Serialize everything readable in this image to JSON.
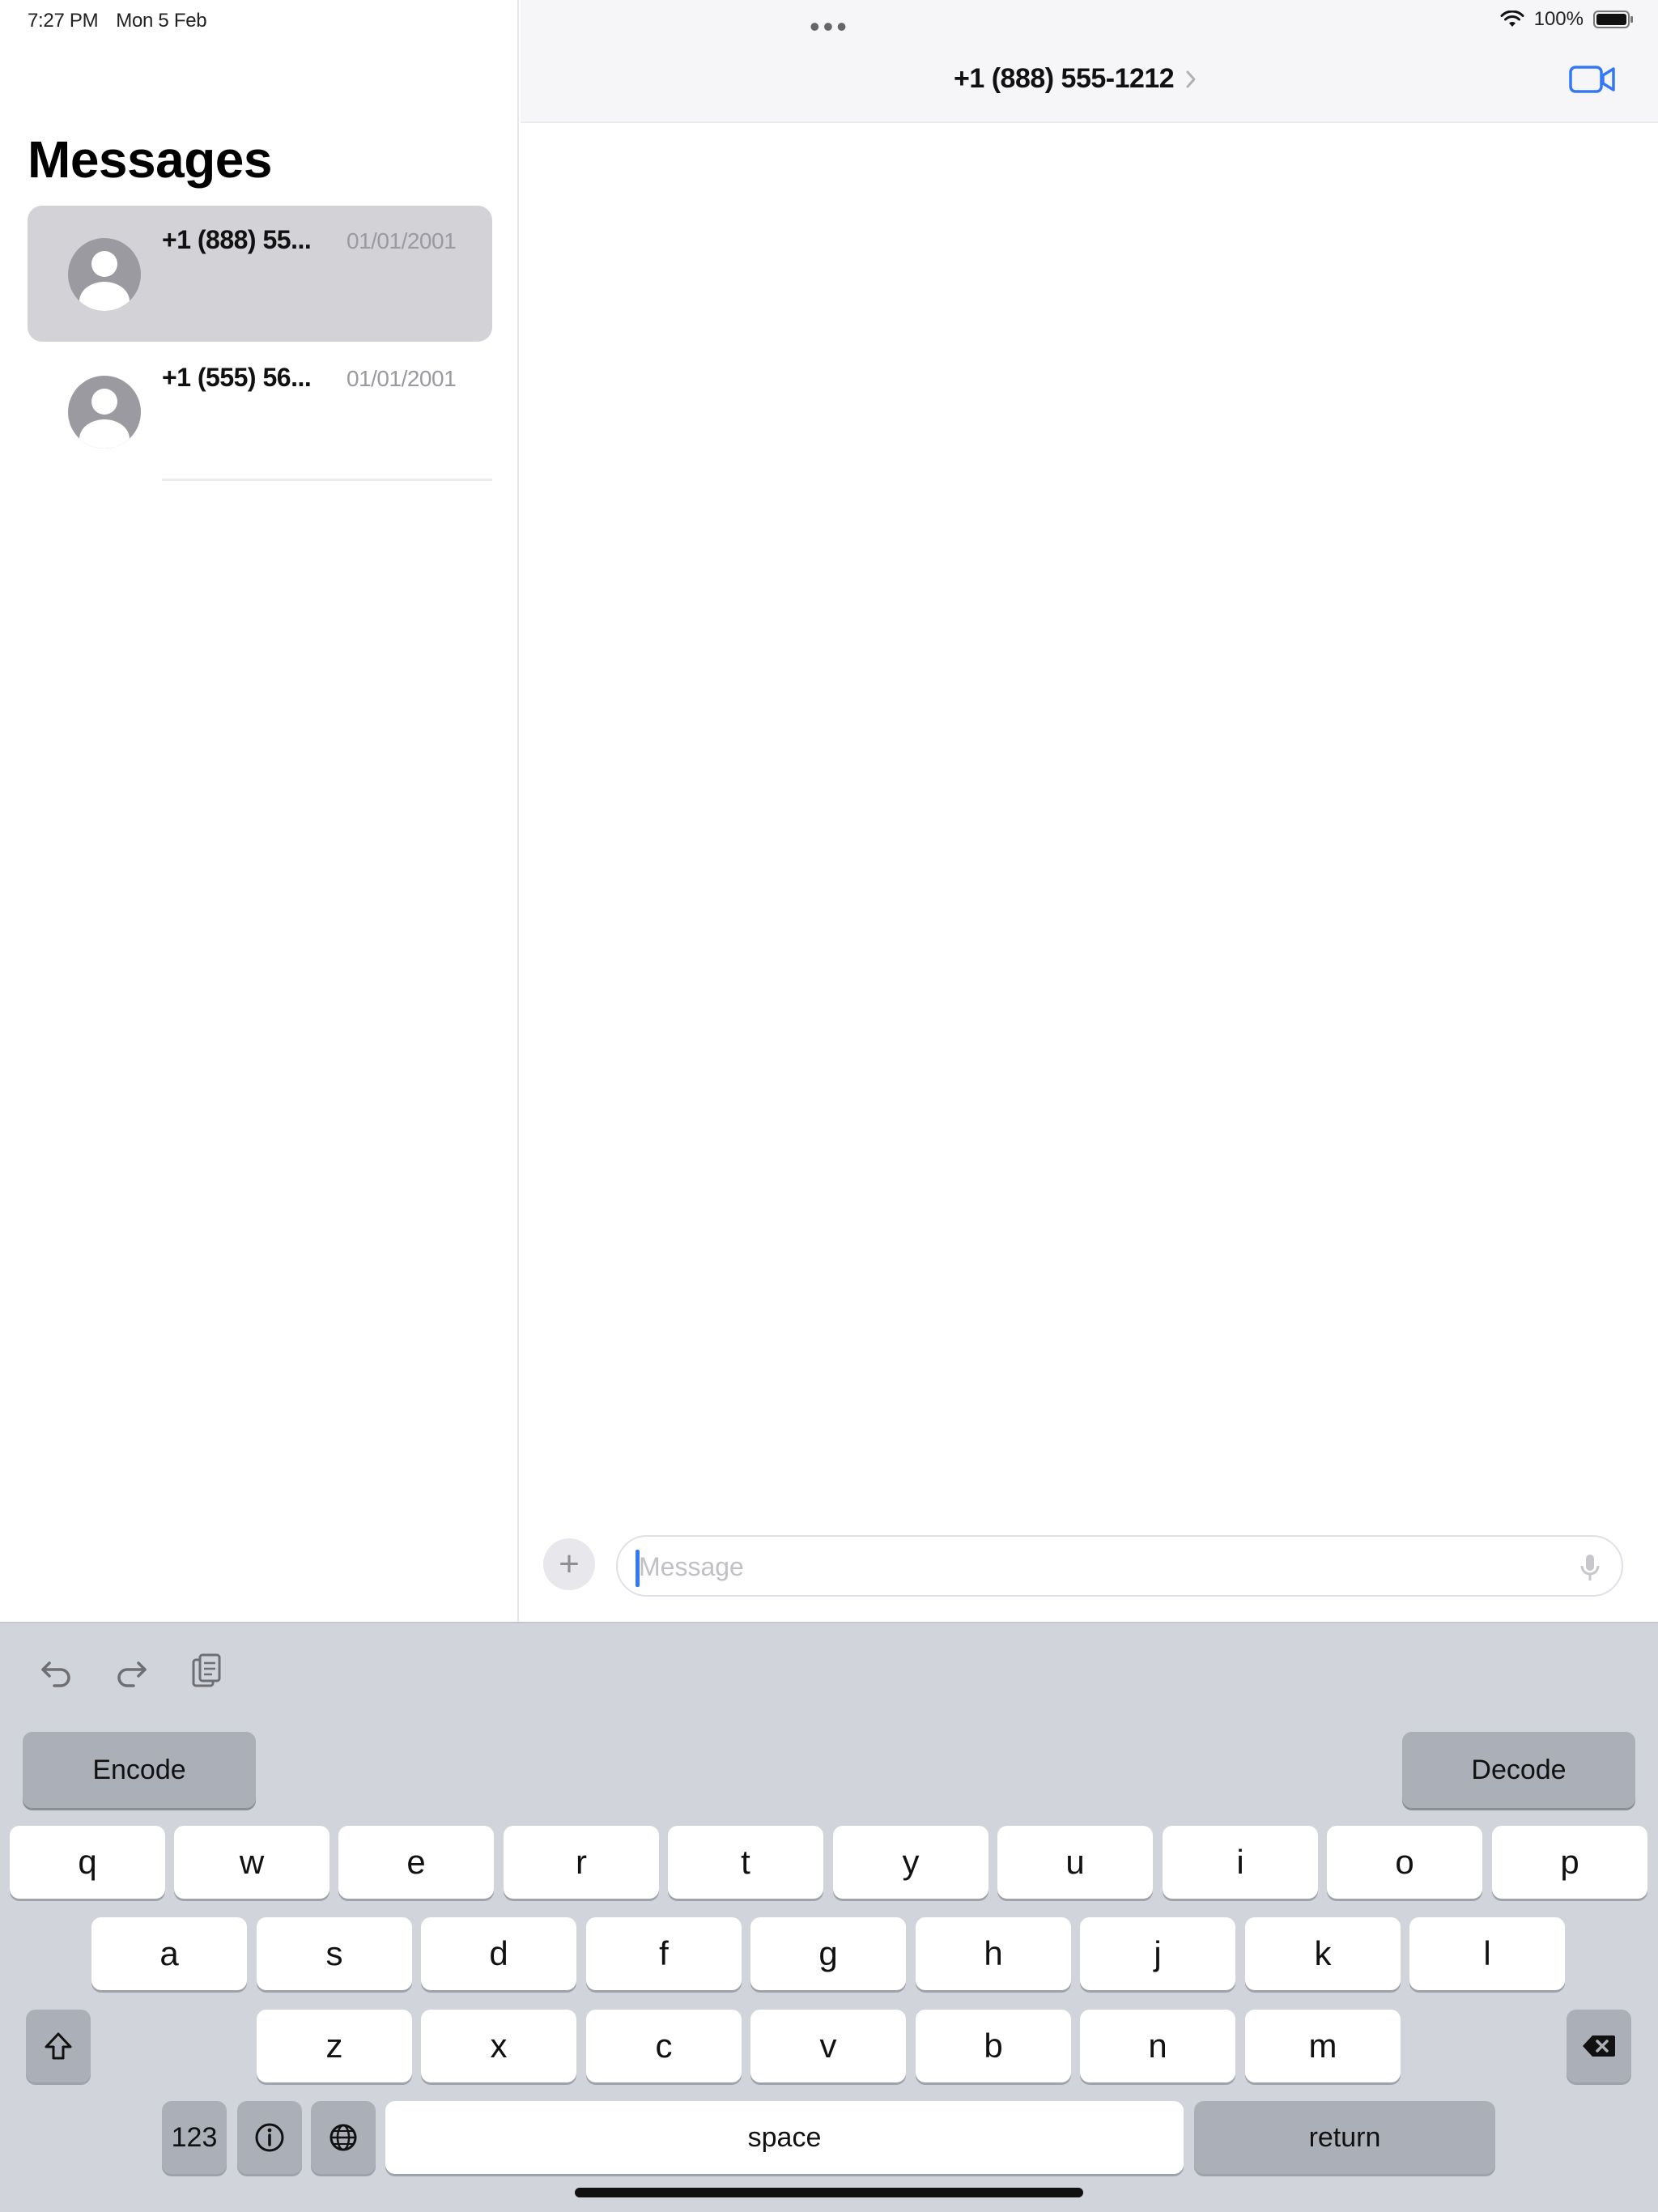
{
  "status_bar": {
    "time": "7:27 PM",
    "date": "Mon 5 Feb",
    "battery": "100%",
    "multitask": "•••"
  },
  "sidebar": {
    "title": "Messages",
    "conversations": [
      {
        "name": "+1 (888) 55...",
        "date": "01/01/2001",
        "selected": true
      },
      {
        "name": "+1 (555) 56...",
        "date": "01/01/2001",
        "selected": false
      }
    ]
  },
  "detail": {
    "contact": "+1 (888) 555-1212",
    "composer": {
      "attach_label": "+",
      "placeholder": "Message",
      "value": ""
    }
  },
  "keyboard": {
    "toolbar": [
      "undo-icon",
      "redo-icon",
      "paste-icon"
    ],
    "encode_label": "Encode",
    "decode_label": "Decode",
    "row1": [
      "q",
      "w",
      "e",
      "r",
      "t",
      "y",
      "u",
      "i",
      "o",
      "p"
    ],
    "row2": [
      "a",
      "s",
      "d",
      "f",
      "g",
      "h",
      "j",
      "k",
      "l"
    ],
    "row3": [
      "z",
      "x",
      "c",
      "v",
      "b",
      "n",
      "m"
    ],
    "row4": {
      "numbers": "123",
      "space": "space",
      "return": "return"
    }
  },
  "colors": {
    "accent": "#3478f6",
    "keyboard_bg": "#d1d4db",
    "selected_row": "#d2d2d7"
  }
}
